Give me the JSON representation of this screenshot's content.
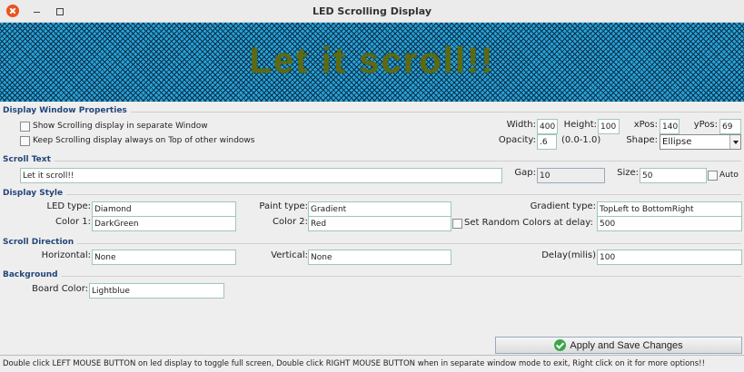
{
  "window": {
    "title": "LED Scrolling Display"
  },
  "led": {
    "text": "Let it scroll!!",
    "background_color": "#26a3d9",
    "text_color": "#5e6a12"
  },
  "display_window": {
    "section_label": "Display Window Properties",
    "separate_window_label": "Show Scrolling display in separate Window",
    "always_on_top_label": "Keep Scrolling display always on Top of other windows",
    "width_label": "Width:",
    "width_value": "400",
    "height_label": "Height:",
    "height_value": "100",
    "xpos_label": "xPos:",
    "xpos_value": "140",
    "ypos_label": "yPos:",
    "ypos_value": "69",
    "opacity_label": "Opacity:",
    "opacity_value": ".6",
    "opacity_range": "(0.0-1.0)",
    "shape_label": "Shape:",
    "shape_value": "Ellipse"
  },
  "scroll_text": {
    "section_label": "Scroll Text",
    "text_value": "Let it scroll!!",
    "gap_label": "Gap:",
    "gap_value": "10",
    "size_label": "Size:",
    "size_value": "50",
    "auto_label": "Auto"
  },
  "display_style": {
    "section_label": "Display Style",
    "led_type_label": "LED type:",
    "led_type_value": "Diamond",
    "paint_type_label": "Paint type:",
    "paint_type_value": "Gradient",
    "gradient_type_label": "Gradient type:",
    "gradient_type_value": "TopLeft to BottomRight",
    "color1_label": "Color 1:",
    "color1_value": "DarkGreen",
    "color2_label": "Color 2:",
    "color2_value": "Red",
    "random_colors_label": "Set Random Colors at delay:",
    "random_delay_value": "500"
  },
  "scroll_direction": {
    "section_label": "Scroll Direction",
    "horizontal_label": "Horizontal:",
    "horizontal_value": "None",
    "vertical_label": "Vertical:",
    "vertical_value": "None",
    "delay_label": "Delay(milis)",
    "delay_value": "100"
  },
  "background": {
    "section_label": "Background",
    "board_color_label": "Board Color:",
    "board_color_value": "Lightblue"
  },
  "apply_button": {
    "label": "Apply and Save Changes",
    "icon": "check-circle-icon"
  },
  "status": {
    "text": "Double click LEFT MOUSE BUTTON on led display to toggle full screen, Double click RIGHT MOUSE BUTTON when in separate window mode to exit, Right click on it for more options!!"
  }
}
